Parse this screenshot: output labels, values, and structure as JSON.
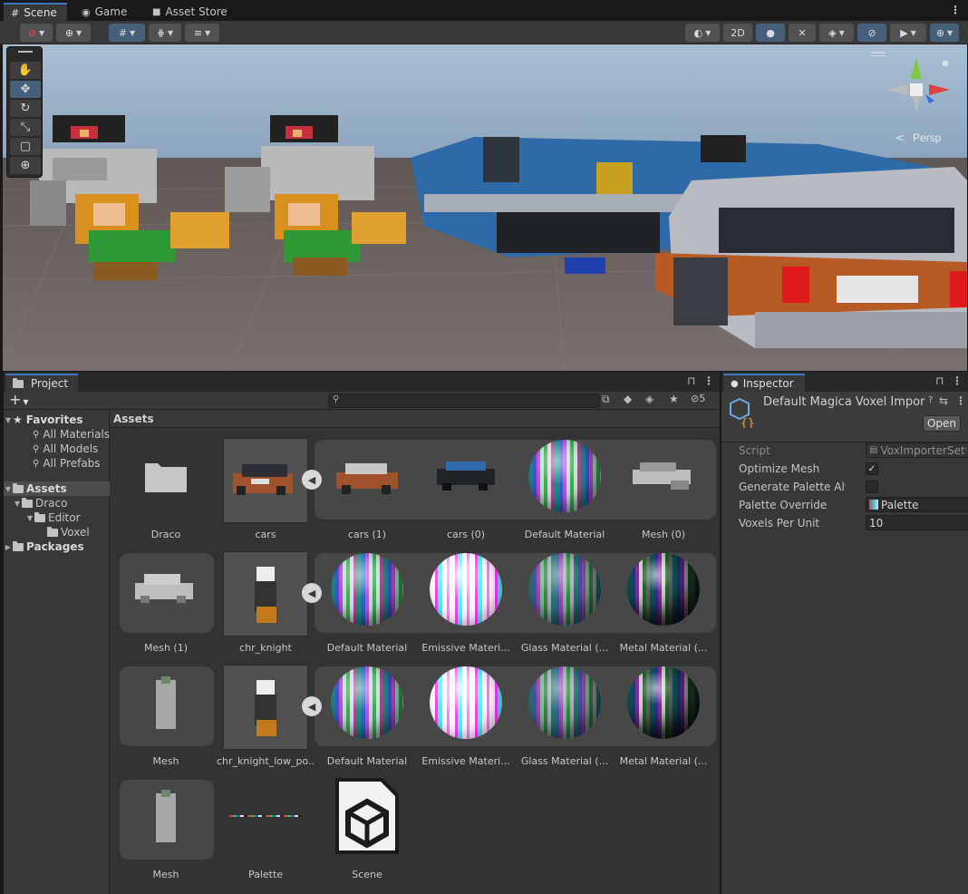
{
  "window_tabs": [
    {
      "label": "Scene",
      "icon": "grid-icon"
    },
    {
      "label": "Game",
      "icon": "gamepad-icon"
    },
    {
      "label": "Asset Store",
      "icon": "bag-icon"
    }
  ],
  "scene_toolbar": {
    "btn_2d": "2D",
    "persp_label": "Persp"
  },
  "project_panel": {
    "tab_label": "Project",
    "add_label": "+",
    "search_placeholder": "",
    "hidden_count": "5",
    "breadcrumb": "Assets"
  },
  "tree": {
    "favorites": "Favorites",
    "fav_items": [
      "All Materials",
      "All Models",
      "All Prefabs"
    ],
    "assets": "Assets",
    "draco": "Draco",
    "editor": "Editor",
    "voxel": "Voxel",
    "packages": "Packages"
  },
  "assets_grid": {
    "row1": [
      "Draco",
      "cars",
      "cars (1)",
      "cars (0)",
      "Default Material",
      "Mesh (0)"
    ],
    "row2": [
      "Mesh (1)",
      "chr_knight",
      "Default Material",
      "Emissive Materi...",
      "Glass Material (...",
      "Metal Material (..."
    ],
    "row3": [
      "Mesh",
      "chr_knight_low_po...",
      "Default Material",
      "Emissive Materi...",
      "Glass Material (...",
      "Metal Material (..."
    ],
    "row4": [
      "Mesh",
      "Palette",
      "Scene"
    ]
  },
  "inspector": {
    "tab_label": "Inspector",
    "title": "Default Magica Voxel Impor",
    "open_button": "Open",
    "fields": {
      "script_label": "Script",
      "script_value": "VoxImporterSett",
      "optimize_label": "Optimize Mesh",
      "optimize_checked": true,
      "genpal_label": "Generate Palette Alw",
      "genpal_checked": false,
      "palette_label": "Palette Override",
      "palette_value": "Palette",
      "vpu_label": "Voxels Per Unit",
      "vpu_value": "10"
    }
  },
  "colors": {
    "accent": "#3a79bb",
    "panel": "#383838",
    "selected": "#46607c"
  }
}
